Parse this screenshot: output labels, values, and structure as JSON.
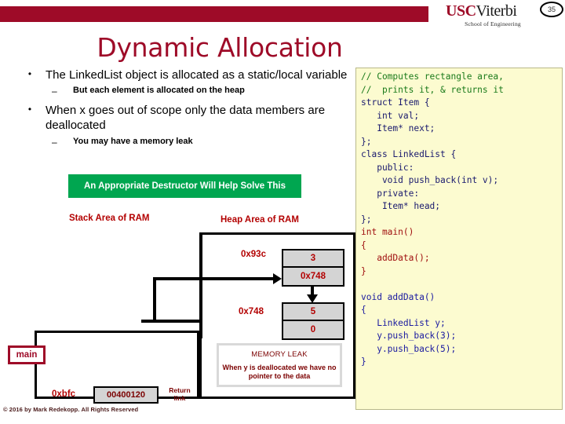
{
  "header": {
    "bar_color": "#9e0b28",
    "logo": {
      "usc": "USC",
      "viterbi": "Viterbi",
      "school": "School of Engineering"
    },
    "slide_number": "35"
  },
  "title": "Dynamic Allocation",
  "bullets": [
    {
      "level": 1,
      "marker": "•",
      "text": "The LinkedList object is allocated as a static/local variable"
    },
    {
      "level": 2,
      "marker": "–",
      "text": "But each element is allocated on the heap"
    },
    {
      "level": 1,
      "marker": "•",
      "text": "When x goes out of scope only the data members are deallocated"
    },
    {
      "level": 2,
      "marker": "–",
      "text": "You may have a memory leak"
    }
  ],
  "callout": {
    "text": "An Appropriate Destructor Will Help Solve This",
    "bg_color": "#00a650",
    "text_color": "#ffffff"
  },
  "diagram": {
    "stack_label": "Stack Area of RAM",
    "heap_label": "Heap Area of RAM",
    "label_color": "#b30000",
    "frame_label": "main",
    "frame_label_color": "#9e0b28",
    "stack_address": "0xbfc",
    "stack_value": "00400120",
    "return_link_label": "Return link",
    "heap_nodes": [
      {
        "address": "0x93c",
        "val": "3",
        "next": "0x748"
      },
      {
        "address": "0x748",
        "val": "5",
        "next": "0"
      }
    ],
    "memory_leak": {
      "title": "MEMORY LEAK",
      "text": "When y is deallocated we have no pointer to the data"
    }
  },
  "code": {
    "bg_color": "#fcfbd0",
    "lines": [
      {
        "text": "// Computes rectangle area,",
        "color": "green"
      },
      {
        "text": "//  prints it, & returns it",
        "color": "green"
      },
      {
        "text": "struct Item {",
        "color": "navy"
      },
      {
        "text": "   int val;",
        "color": "navy"
      },
      {
        "text": "   Item* next;",
        "color": "navy"
      },
      {
        "text": "};",
        "color": "navy"
      },
      {
        "text": "class LinkedList {",
        "color": "navy"
      },
      {
        "text": "   public:",
        "color": "navy"
      },
      {
        "text": "    void push_back(int v);",
        "color": "navy"
      },
      {
        "text": "   private:",
        "color": "navy"
      },
      {
        "text": "    Item* head;",
        "color": "navy"
      },
      {
        "text": "};",
        "color": "navy"
      },
      {
        "text": "int main()",
        "color": "red"
      },
      {
        "text": "{",
        "color": "red"
      },
      {
        "text": "   addData();",
        "color": "red"
      },
      {
        "text": "}",
        "color": "red"
      },
      {
        "text": "",
        "color": "navy"
      },
      {
        "text": "void addData()",
        "color": "blue"
      },
      {
        "text": "{",
        "color": "blue"
      },
      {
        "text": "   LinkedList y;",
        "color": "blue"
      },
      {
        "text": "   y.push_back(3);",
        "color": "blue"
      },
      {
        "text": "   y.push_back(5);",
        "color": "blue"
      },
      {
        "text": "}",
        "color": "blue"
      }
    ]
  },
  "copyright": "© 2016 by Mark Redekopp. All Rights Reserved"
}
